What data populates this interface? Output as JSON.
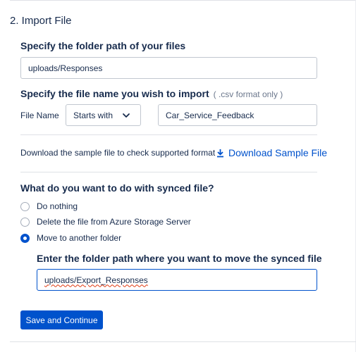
{
  "section": {
    "title": "2. Import File"
  },
  "folder_path": {
    "label": "Specify the folder path of your files",
    "value": "uploads/Responses"
  },
  "file_name": {
    "label": "Specify the file name you wish to import",
    "hint": "( .csv format only )",
    "field_label": "File Name",
    "match_mode": "Starts with",
    "value": "Car_Service_Feedback"
  },
  "sample": {
    "text": "Download the sample file to check supported format",
    "link_label": "Download Sample File"
  },
  "synced": {
    "question": "What do you want to do with synced file?",
    "options": [
      {
        "label": "Do nothing",
        "checked": false
      },
      {
        "label": "Delete the file from Azure Storage Server",
        "checked": false
      },
      {
        "label": "Move to another folder",
        "checked": true
      }
    ],
    "move_label": "Enter the folder path where you want to move the synced file",
    "move_value": "uploads/Export_Responses"
  },
  "actions": {
    "save_label": "Save and Continue"
  },
  "colors": {
    "accent": "#0052cc",
    "text": "#172b4d",
    "border": "#c1c7d0"
  }
}
